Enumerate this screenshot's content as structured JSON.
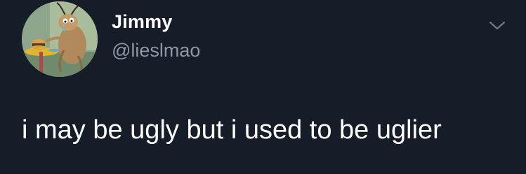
{
  "tweet": {
    "author": {
      "display_name": "Jimmy",
      "handle": "@lieslmao",
      "avatar_icon": "cartoon-cockroach-avatar"
    },
    "text": "i may be ugly but i used to be uglier",
    "menu_icon": "chevron-down-icon"
  },
  "colors": {
    "background": "#161d28",
    "primary_text": "#ffffff",
    "secondary_text": "#8b98a5"
  }
}
